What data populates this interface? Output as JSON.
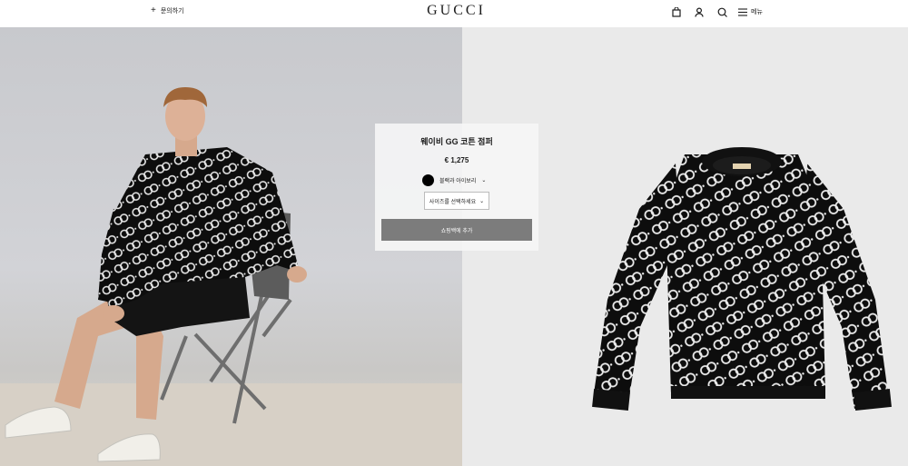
{
  "header": {
    "contact_icon": "plus-icon",
    "contact_label": "문의하기",
    "logo": "GUCCI",
    "icons": [
      "shopping-bag-icon",
      "user-icon",
      "search-icon",
      "menu-icon"
    ],
    "menu_label": "메뉴"
  },
  "product": {
    "name": "웨이비 GG 코튼 점퍼",
    "price": "€ 1,275",
    "color": {
      "label": "블랙과 아이보리",
      "swatch": "#000000"
    },
    "size_placeholder": "사이즈를 선택하세요",
    "add_to_bag": "쇼핑백에 추가"
  },
  "images": {
    "left": "model-seated-wearing-sweater-photo",
    "right": "black-gg-sweater-product-photo"
  },
  "colors": {
    "header_bg": "#ffffff",
    "left_bg": "#cfd0d4",
    "right_bg": "#eaeaea",
    "button_bg": "#7c7c7c"
  }
}
